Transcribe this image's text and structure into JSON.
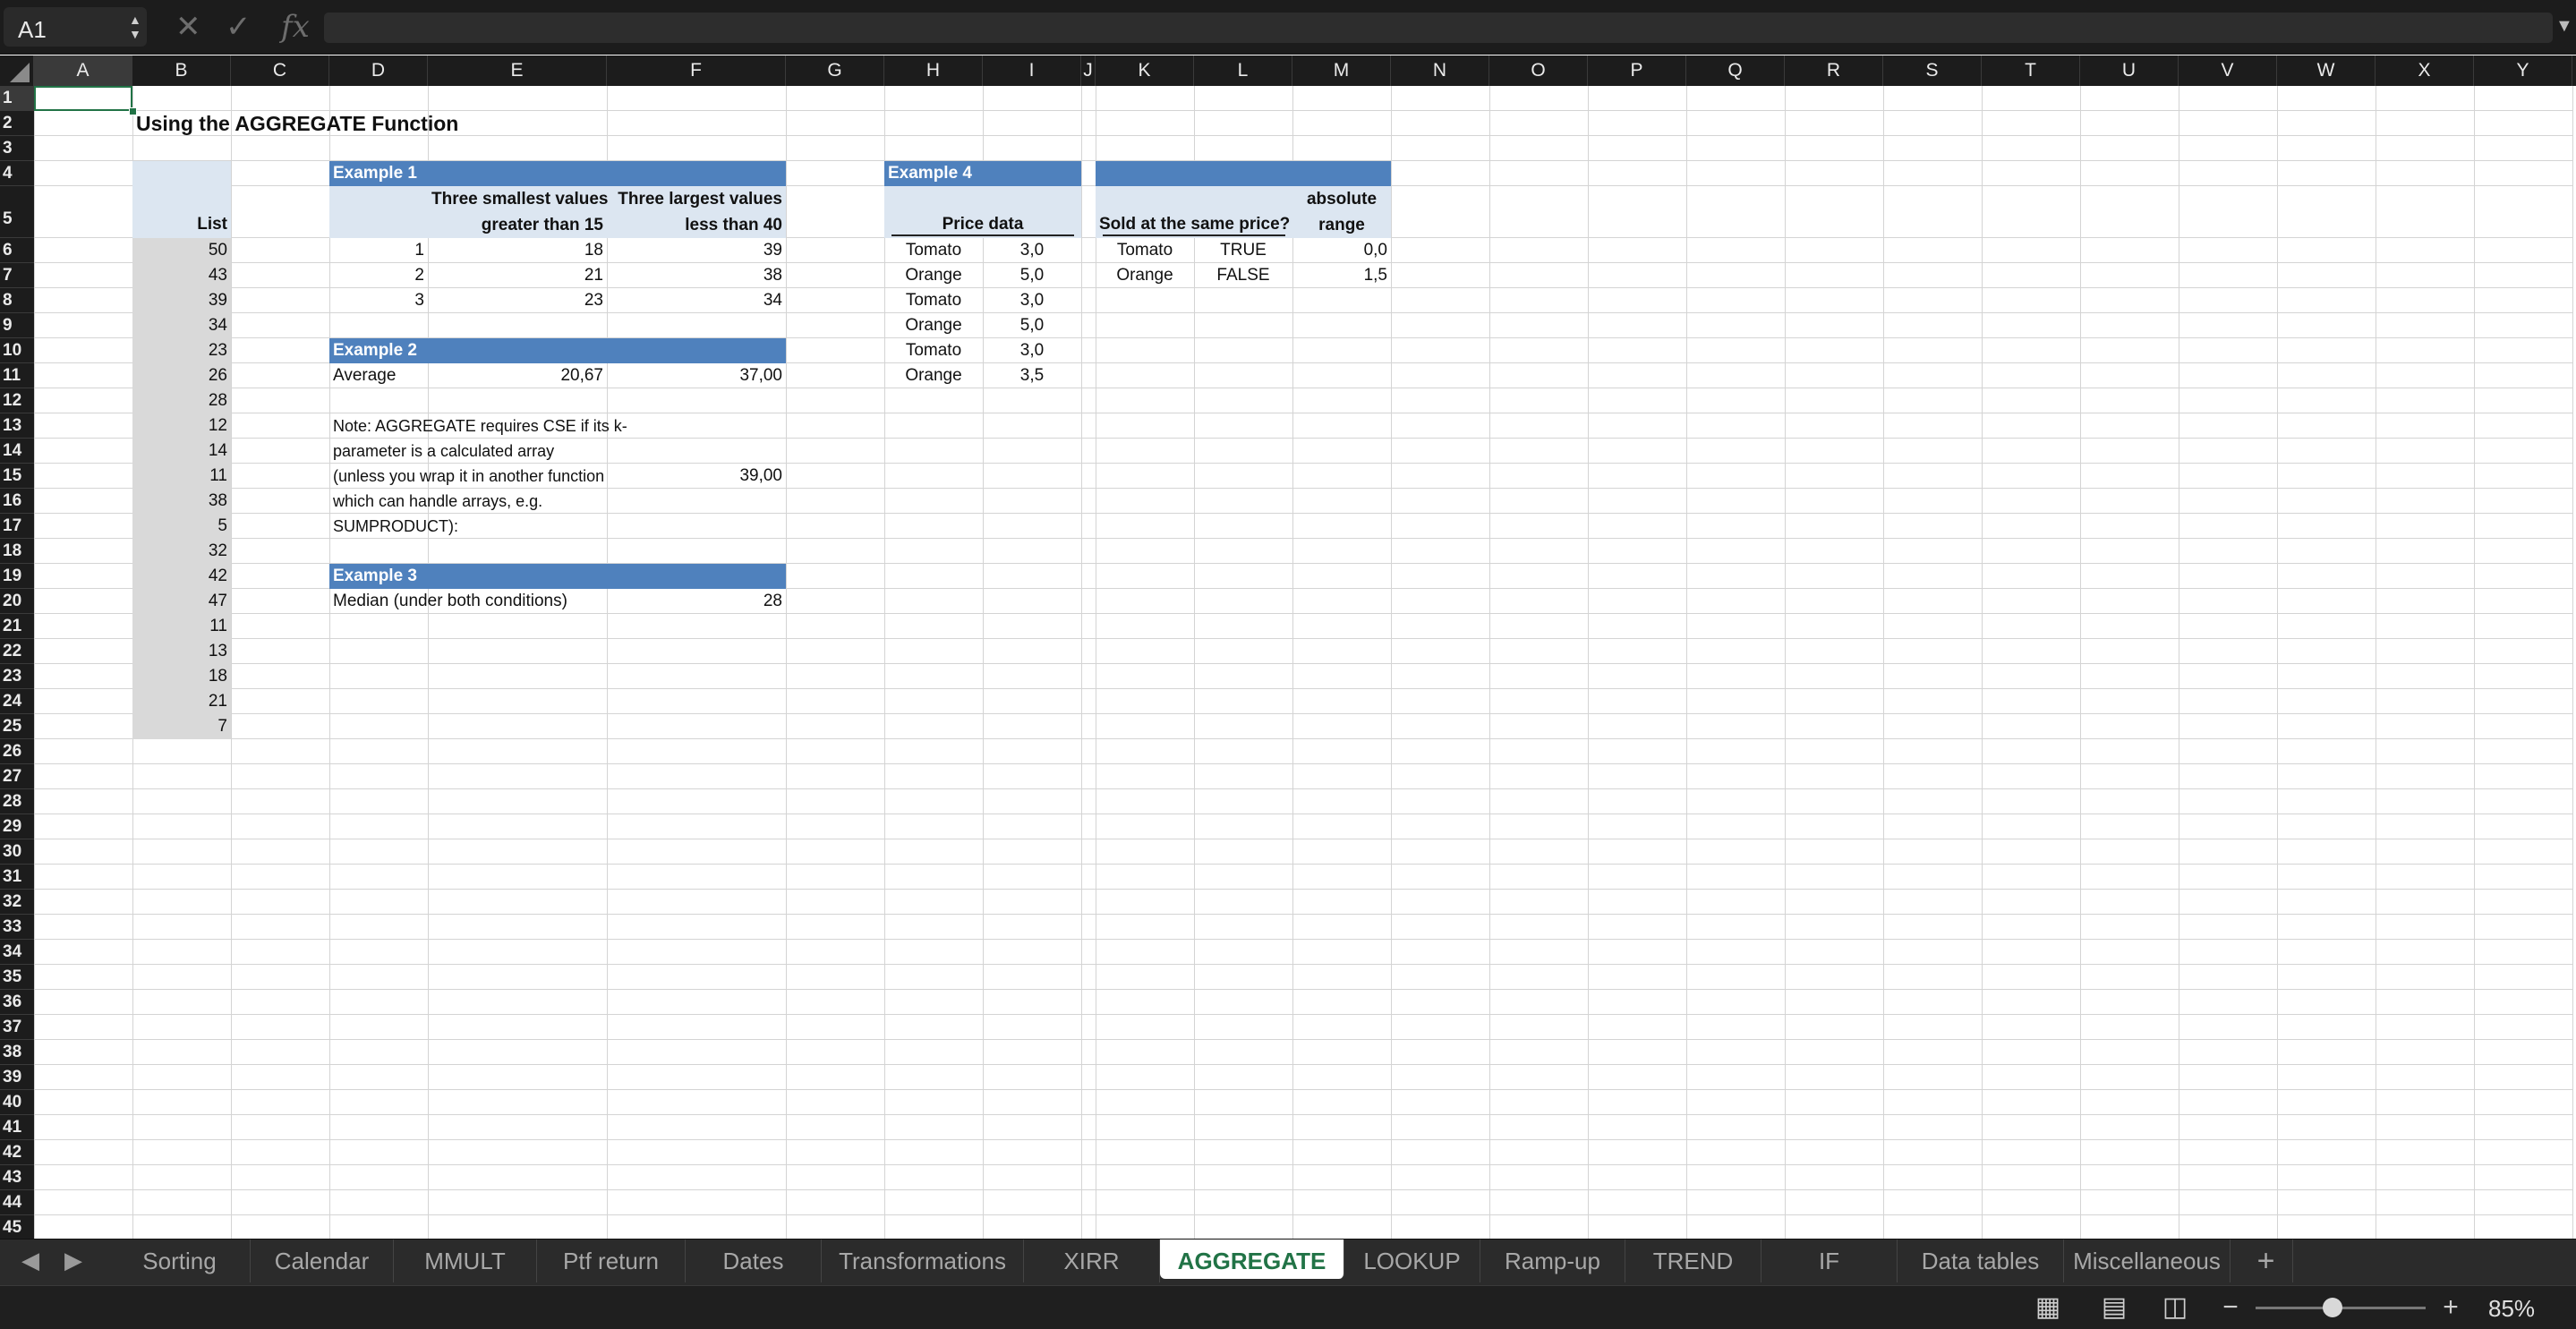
{
  "formula_bar": {
    "cell_reference": "A1",
    "cancel_icon": "x-icon",
    "enter_icon": "checkmark-icon",
    "fx_label": "fx",
    "formula": ""
  },
  "columns": [
    "A",
    "B",
    "C",
    "D",
    "E",
    "F",
    "G",
    "H",
    "I",
    "J",
    "K",
    "L",
    "M",
    "N",
    "O",
    "P",
    "Q",
    "R",
    "S",
    "T",
    "U",
    "V",
    "W",
    "X",
    "Y"
  ],
  "selected_column": "A",
  "rows": [
    "1",
    "2",
    "3",
    "4",
    "5",
    "6",
    "7",
    "8",
    "9",
    "10",
    "11",
    "12",
    "13",
    "14",
    "15",
    "16",
    "17",
    "18",
    "19",
    "20",
    "21",
    "22",
    "23",
    "24",
    "25",
    "26",
    "27",
    "28",
    "29",
    "30",
    "31",
    "32",
    "33",
    "34",
    "35",
    "36",
    "37",
    "38",
    "39",
    "40",
    "41",
    "42",
    "43",
    "44",
    "45"
  ],
  "selected_row": "1",
  "sheet": {
    "title": "Using the AGGREGATE Function",
    "list_header": "List",
    "list_values": [
      "50",
      "43",
      "39",
      "34",
      "23",
      "26",
      "28",
      "12",
      "14",
      "11",
      "38",
      "5",
      "32",
      "42",
      "47",
      "11",
      "13",
      "18",
      "21",
      "7"
    ],
    "example1": {
      "title": "Example 1",
      "header_e_line1": "Three smallest values",
      "header_e_line2": "greater than 15",
      "header_f_line1": "Three largest values",
      "header_f_line2": "less than 40",
      "rows": [
        {
          "k": "1",
          "small": "18",
          "large": "39"
        },
        {
          "k": "2",
          "small": "21",
          "large": "38"
        },
        {
          "k": "3",
          "small": "23",
          "large": "34"
        }
      ]
    },
    "example2": {
      "title": "Example 2",
      "label": "Average",
      "value_e": "20,67",
      "value_f": "37,00",
      "note_lines": [
        "Note: AGGREGATE requires CSE if its k-",
        "parameter is a calculated array",
        "(unless you wrap it in another function",
        "which can handle arrays, e.g.",
        "SUMPRODUCT):"
      ],
      "note_value": "39,00"
    },
    "example3": {
      "title": "Example 3",
      "label": "Median (under both conditions)",
      "value": "28"
    },
    "example4": {
      "title": "Example 4",
      "price_header": "Price data",
      "prices": [
        {
          "item": "Tomato",
          "price": "3,0"
        },
        {
          "item": "Orange",
          "price": "5,0"
        },
        {
          "item": "Tomato",
          "price": "3,0"
        },
        {
          "item": "Orange",
          "price": "5,0"
        },
        {
          "item": "Tomato",
          "price": "3,0"
        },
        {
          "item": "Orange",
          "price": "3,5"
        }
      ],
      "sold_header": "Sold at the same price?",
      "range_header_line1": "absolute",
      "range_header_line2": "range",
      "results": [
        {
          "item": "Tomato",
          "same": "TRUE",
          "range": "0,0"
        },
        {
          "item": "Orange",
          "same": "FALSE",
          "range": "1,5"
        }
      ]
    }
  },
  "tabs": [
    {
      "label": "Sorting",
      "active": false
    },
    {
      "label": "Calendar",
      "active": false
    },
    {
      "label": "MMULT",
      "active": false
    },
    {
      "label": "Ptf return",
      "active": false
    },
    {
      "label": "Dates",
      "active": false
    },
    {
      "label": "Transformations",
      "active": false
    },
    {
      "label": "XIRR",
      "active": false
    },
    {
      "label": "AGGREGATE",
      "active": true
    },
    {
      "label": "LOOKUP",
      "active": false
    },
    {
      "label": "Ramp-up",
      "active": false
    },
    {
      "label": "TREND",
      "active": false
    },
    {
      "label": "IF",
      "active": false
    },
    {
      "label": "Data tables",
      "active": false
    },
    {
      "label": "Miscellaneous",
      "active": false
    }
  ],
  "add_sheet_label": "+",
  "status_bar": {
    "normal_view_icon": "grid-icon",
    "page_layout_icon": "page-layout-icon",
    "page_break_icon": "page-break-icon",
    "zoom_out_label": "−",
    "zoom_in_label": "+",
    "zoom_level": "85%",
    "zoom_fraction": 0.45
  },
  "colors": {
    "header_blue": "#4f81bd",
    "light_blue": "#dce6f1",
    "list_gray": "#d9d9d9",
    "active_tab_text": "#217346",
    "selection_green": "#217346"
  }
}
